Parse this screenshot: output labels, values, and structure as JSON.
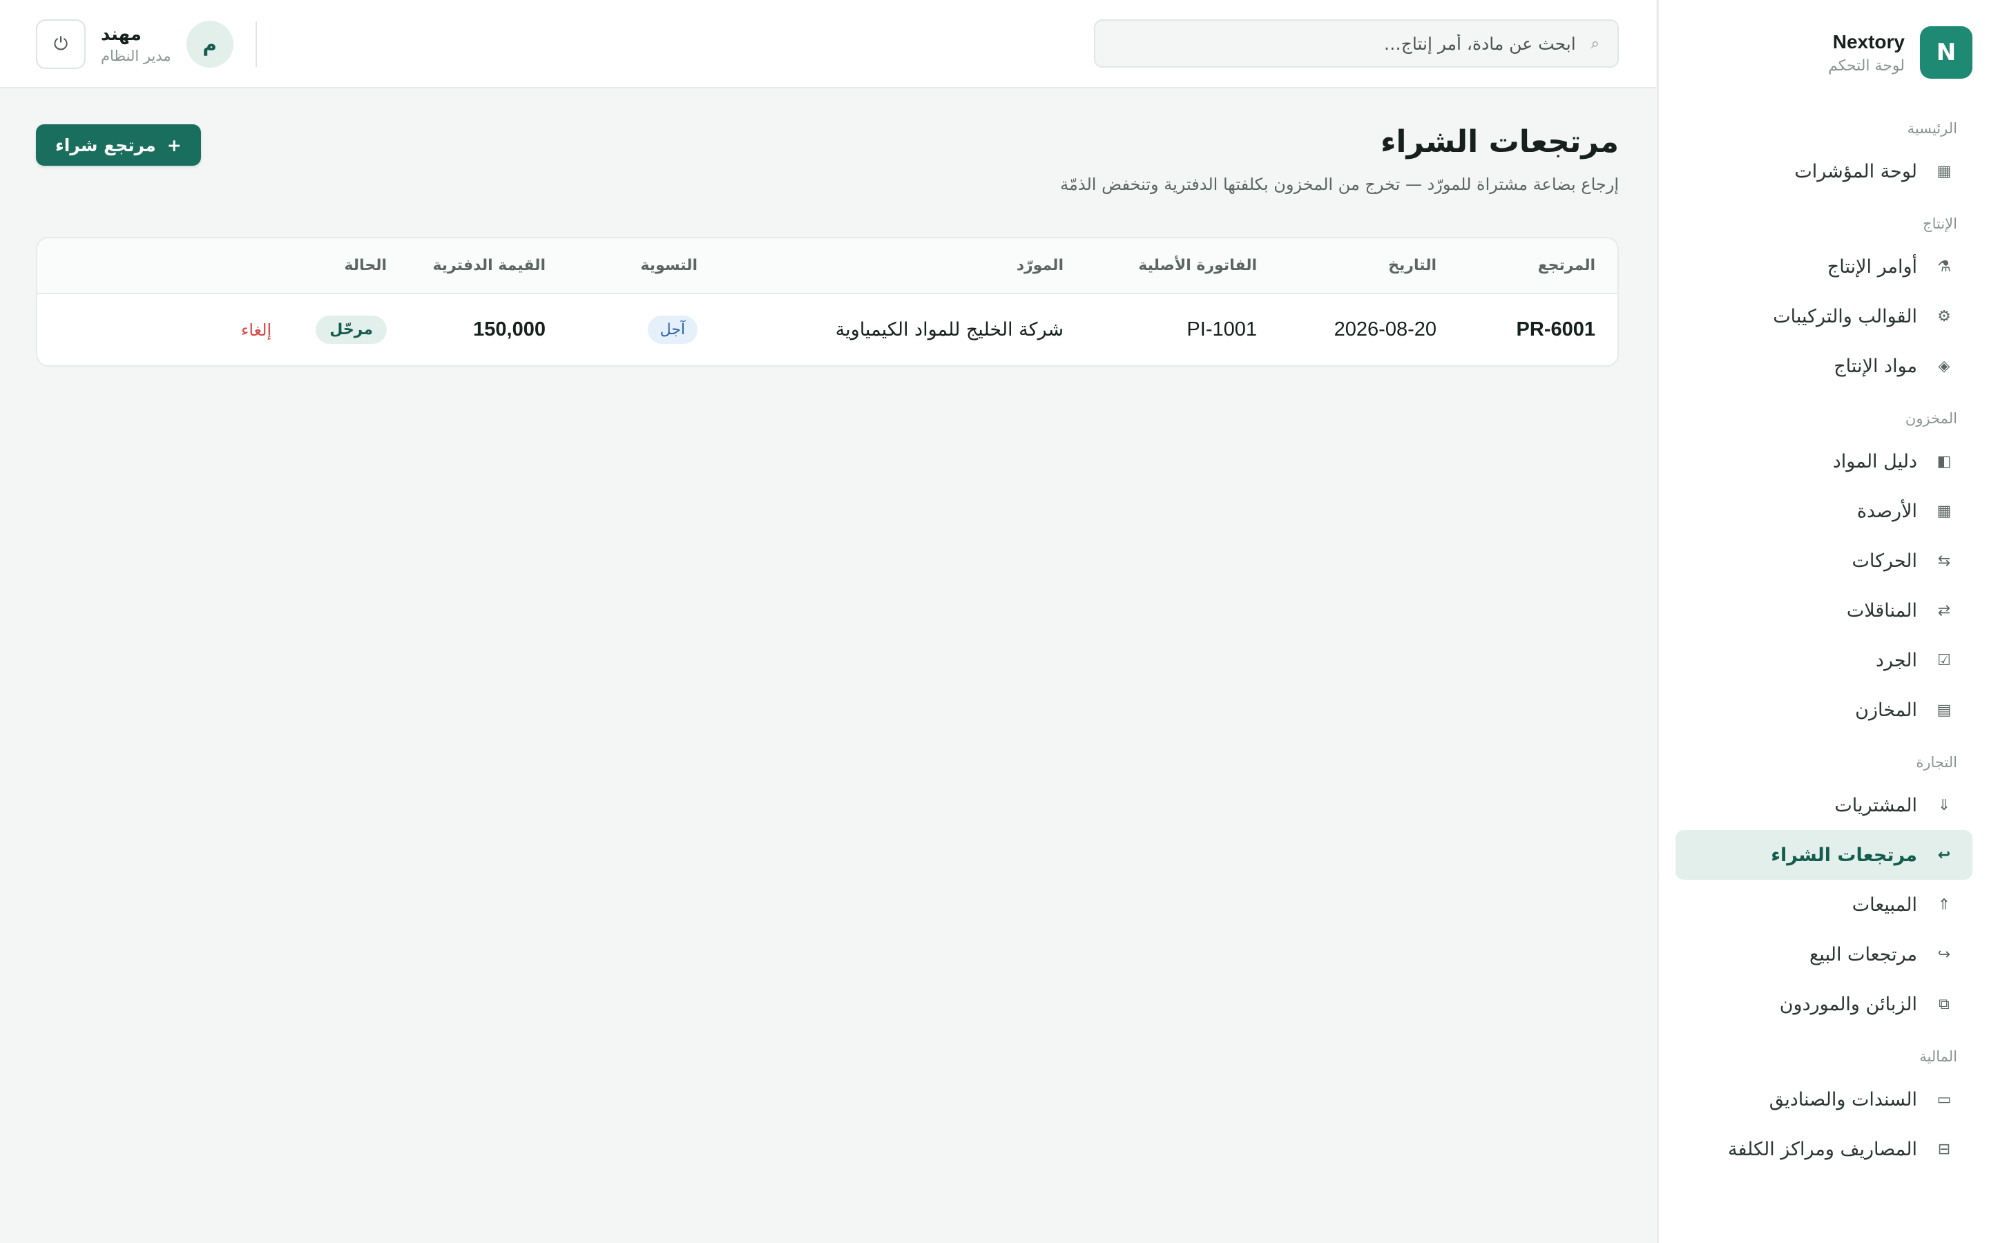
{
  "brand": {
    "logo_letter": "N",
    "name": "Nextory",
    "subtitle": "لوحة التحكم"
  },
  "nav": {
    "sections": [
      {
        "title": "الرئيسية",
        "items": [
          {
            "label": "لوحة المؤشرات",
            "icon": "▦",
            "icon_name": "dashboard-icon"
          }
        ]
      },
      {
        "title": "الإنتاج",
        "items": [
          {
            "label": "أوامر الإنتاج",
            "icon": "⚗",
            "icon_name": "production-orders-icon"
          },
          {
            "label": "القوالب والتركيبات",
            "icon": "⚙",
            "icon_name": "templates-icon"
          },
          {
            "label": "مواد الإنتاج",
            "icon": "◈",
            "icon_name": "production-materials-icon"
          }
        ]
      },
      {
        "title": "المخزون",
        "items": [
          {
            "label": "دليل المواد",
            "icon": "◧",
            "icon_name": "materials-directory-icon"
          },
          {
            "label": "الأرصدة",
            "icon": "▦",
            "icon_name": "balances-icon"
          },
          {
            "label": "الحركات",
            "icon": "⇆",
            "icon_name": "movements-icon"
          },
          {
            "label": "المناقلات",
            "icon": "⇄",
            "icon_name": "transfers-icon"
          },
          {
            "label": "الجرد",
            "icon": "☑",
            "icon_name": "stocktake-icon"
          },
          {
            "label": "المخازن",
            "icon": "▤",
            "icon_name": "warehouses-icon"
          }
        ]
      },
      {
        "title": "التجارة",
        "items": [
          {
            "label": "المشتريات",
            "icon": "⇓",
            "icon_name": "purchases-icon"
          },
          {
            "label": "مرتجعات الشراء",
            "icon": "↩",
            "icon_name": "purchase-returns-icon",
            "active": true
          },
          {
            "label": "المبيعات",
            "icon": "⇑",
            "icon_name": "sales-icon"
          },
          {
            "label": "مرتجعات البيع",
            "icon": "↪",
            "icon_name": "sales-returns-icon"
          },
          {
            "label": "الزبائن والموردون",
            "icon": "⧉",
            "icon_name": "customers-suppliers-icon"
          }
        ]
      },
      {
        "title": "المالية",
        "items": [
          {
            "label": "السندات والصناديق",
            "icon": "▭",
            "icon_name": "vouchers-icon"
          },
          {
            "label": "المصاريف ومراكز الكلفة",
            "icon": "⊟",
            "icon_name": "expenses-icon"
          }
        ]
      }
    ]
  },
  "search": {
    "placeholder": "ابحث عن مادة، أمر إنتاج…",
    "value": ""
  },
  "user": {
    "avatar_letter": "م",
    "name": "مهند",
    "role": "مدير النظام"
  },
  "page": {
    "title": "مرتجعات الشراء",
    "subtitle": "إرجاع بضاعة مشتراة للمورّد — تخرج من المخزون بكلفتها الدفترية وتنخفض الذمّة",
    "add_button": "مرتجع شراء",
    "add_button_icon": "+"
  },
  "table": {
    "headers": [
      "المرتجع",
      "التاريخ",
      "الفاتورة الأصلية",
      "المورّد",
      "التسوية",
      "القيمة الدفترية",
      "الحالة",
      ""
    ],
    "rows": [
      {
        "ref": "PR-6001",
        "date": "2026-08-20",
        "invoice": "PI-1001",
        "supplier": "شركة الخليج للمواد الكيمياوية",
        "settlement": "آجل",
        "book_value": "150,000",
        "status": "مرحّل",
        "action": "إلغاء"
      }
    ]
  }
}
